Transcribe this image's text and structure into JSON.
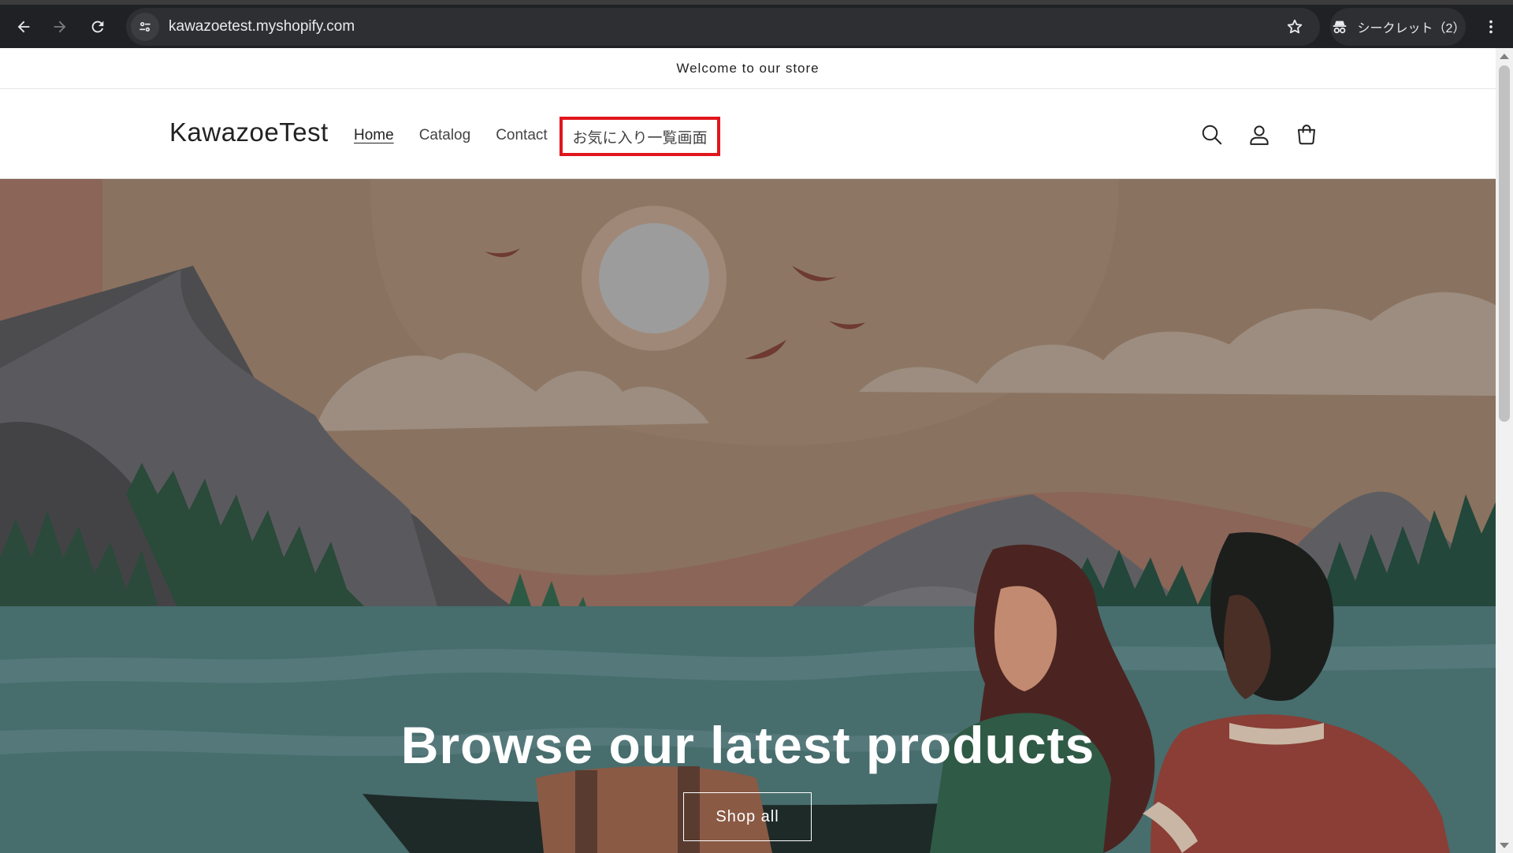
{
  "browser": {
    "url": "kawazoetest.myshopify.com",
    "incognito_label": "シークレット（2）",
    "icons": [
      "back-icon",
      "forward-icon",
      "reload-icon",
      "site-info-icon",
      "star-icon",
      "incognito-icon",
      "menu-icon"
    ]
  },
  "announcement": {
    "text": "Welcome to our store"
  },
  "header": {
    "logo": "KawazoeTest",
    "nav": {
      "home": "Home",
      "catalog": "Catalog",
      "contact": "Contact",
      "favorites": "お気に入り一覧画面"
    },
    "icons": [
      "search-icon",
      "account-icon",
      "cart-icon"
    ]
  },
  "hero": {
    "title": "Browse our latest products",
    "button": "Shop all"
  },
  "colors": {
    "highlight": "#e1161d",
    "sky": "#8a7260",
    "water": "#476d6d"
  }
}
